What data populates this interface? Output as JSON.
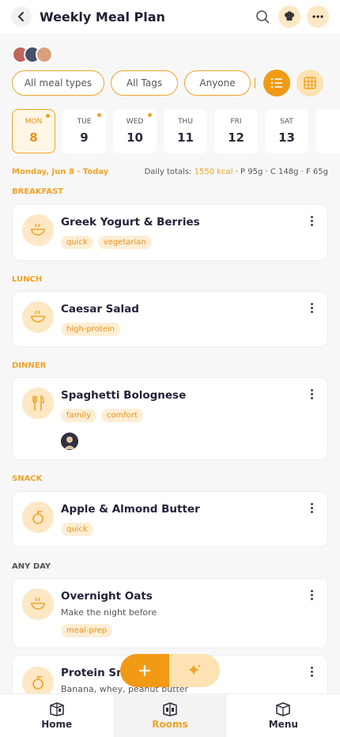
{
  "header": {
    "title": "Weekly Meal Plan"
  },
  "filters": {
    "meal_types": "All meal types",
    "tags": "All Tags",
    "person": "Anyone"
  },
  "days": [
    {
      "name": "MON",
      "num": "8",
      "selected": true,
      "dot": true
    },
    {
      "name": "TUE",
      "num": "9",
      "selected": false,
      "dot": true
    },
    {
      "name": "WED",
      "num": "10",
      "selected": false,
      "dot": true
    },
    {
      "name": "THU",
      "num": "11",
      "selected": false,
      "dot": false
    },
    {
      "name": "FRI",
      "num": "12",
      "selected": false,
      "dot": false
    },
    {
      "name": "SAT",
      "num": "13",
      "selected": false,
      "dot": false
    }
  ],
  "summary": {
    "day_label": "Monday, Jun 8 · Today",
    "totals_label": "Daily totals: ",
    "kcal": "1550 kcal",
    "macros": " · P 95g · C 148g · F 65g"
  },
  "sections": {
    "breakfast": "BREAKFAST",
    "lunch": "LUNCH",
    "dinner": "DINNER",
    "snack": "SNACK",
    "anyday": "ANY DAY"
  },
  "meals": {
    "breakfast": {
      "name": "Greek Yogurt & Berries",
      "tags": [
        "quick",
        "vegetarian"
      ],
      "icon": "bowl-icon"
    },
    "lunch": {
      "name": "Caesar Salad",
      "tags": [
        "high-protein"
      ],
      "icon": "bowl-icon"
    },
    "dinner": {
      "name": "Spaghetti Bolognese",
      "tags": [
        "family",
        "comfort"
      ],
      "icon": "fork-knife-icon"
    },
    "snack": {
      "name": "Apple & Almond Butter",
      "tags": [
        "quick"
      ],
      "icon": "apple-icon"
    },
    "anyday1": {
      "name": "Overnight Oats",
      "desc": "Make the night before",
      "tags": [
        "meal-prep"
      ],
      "icon": "bowl-icon"
    },
    "anyday2": {
      "name": "Protein Smoothie",
      "desc": "Banana, whey, peanut butter",
      "icon": "apple-icon"
    }
  },
  "nav": {
    "home": "Home",
    "rooms": "Rooms",
    "menu": "Menu"
  },
  "colors": {
    "accent": "#f0a326",
    "accent_light": "#fde7c4",
    "text": "#2a2a3a"
  }
}
